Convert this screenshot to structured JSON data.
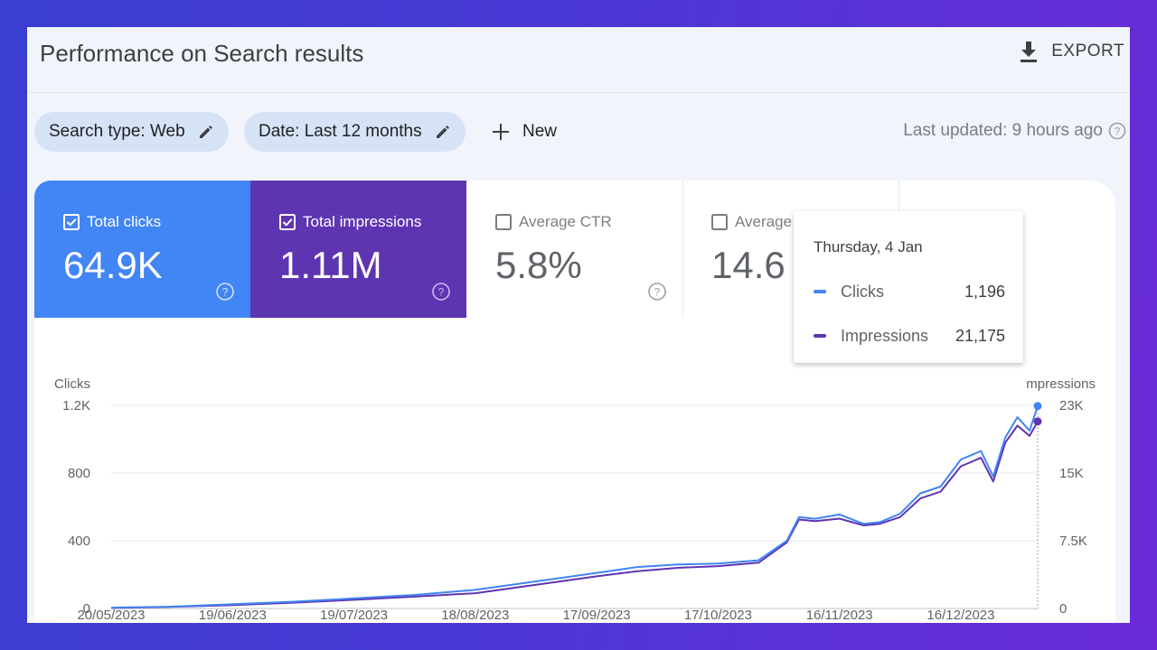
{
  "header": {
    "title": "Performance on Search results",
    "export_label": "EXPORT"
  },
  "filters": {
    "search_type": "Search type: Web",
    "date": "Date: Last 12 months",
    "new_label": "New",
    "last_updated": "Last updated: 9 hours ago"
  },
  "cards": [
    {
      "label": "Total clicks",
      "value": "64.9K",
      "checked": true
    },
    {
      "label": "Total impressions",
      "value": "1.11M",
      "checked": true
    },
    {
      "label": "Average CTR",
      "value": "5.8%",
      "checked": false
    },
    {
      "label": "Average",
      "value": "14.6",
      "checked": false
    }
  ],
  "tooltip": {
    "date": "Thursday, 4 Jan",
    "rows": [
      {
        "label": "Clicks",
        "value": "1,196"
      },
      {
        "label": "Impressions",
        "value": "21,175"
      }
    ]
  },
  "colors": {
    "clicks": "#4285f4",
    "impressions": "#5e35b1"
  },
  "chart_data": {
    "type": "line",
    "ylabel_left": "Clicks",
    "ylabel_right": "mpressions",
    "yticks_left": [
      "0",
      "400",
      "800",
      "1.2K"
    ],
    "yticks_right": [
      "0",
      "7.5K",
      "15K",
      "23K"
    ],
    "ylim_left": [
      0,
      1200
    ],
    "ylim_right": [
      0,
      23000
    ],
    "x_tick_labels": [
      "20/05/2023",
      "19/06/2023",
      "19/07/2023",
      "18/08/2023",
      "17/09/2023",
      "17/10/2023",
      "16/11/2023",
      "16/12/2023"
    ],
    "xlim": [
      "2023-05-20",
      "2024-01-04"
    ],
    "grid": true,
    "series": [
      {
        "name": "Clicks",
        "x": [
          "2023-05-20",
          "2023-06-03",
          "2023-06-19",
          "2023-07-04",
          "2023-07-19",
          "2023-08-03",
          "2023-08-18",
          "2023-09-02",
          "2023-09-17",
          "2023-09-27",
          "2023-10-07",
          "2023-10-17",
          "2023-10-27",
          "2023-11-03",
          "2023-11-06",
          "2023-11-10",
          "2023-11-16",
          "2023-11-22",
          "2023-11-26",
          "2023-12-01",
          "2023-12-06",
          "2023-12-11",
          "2023-12-16",
          "2023-12-21",
          "2023-12-24",
          "2023-12-27",
          "2023-12-30",
          "2024-01-02",
          "2024-01-04"
        ],
        "y": [
          5,
          10,
          25,
          40,
          60,
          80,
          110,
          160,
          210,
          245,
          260,
          265,
          285,
          400,
          540,
          530,
          555,
          500,
          510,
          560,
          680,
          720,
          880,
          930,
          780,
          1010,
          1130,
          1050,
          1196
        ]
      },
      {
        "name": "Impressions",
        "x": [
          "2023-05-20",
          "2023-06-03",
          "2023-06-19",
          "2023-07-04",
          "2023-07-19",
          "2023-08-03",
          "2023-08-18",
          "2023-09-02",
          "2023-09-17",
          "2023-09-27",
          "2023-10-07",
          "2023-10-17",
          "2023-10-27",
          "2023-11-03",
          "2023-11-06",
          "2023-11-10",
          "2023-11-16",
          "2023-11-22",
          "2023-11-26",
          "2023-12-01",
          "2023-12-06",
          "2023-12-11",
          "2023-12-16",
          "2023-12-21",
          "2023-12-24",
          "2023-12-27",
          "2023-12-30",
          "2024-01-02",
          "2024-01-04"
        ],
        "y": [
          50,
          180,
          380,
          650,
          980,
          1340,
          1730,
          2680,
          3640,
          4220,
          4600,
          4790,
          5180,
          7480,
          10070,
          9880,
          10170,
          9400,
          9590,
          10350,
          12460,
          13230,
          16100,
          17060,
          14380,
          18790,
          20700,
          19550,
          21175
        ]
      }
    ]
  }
}
